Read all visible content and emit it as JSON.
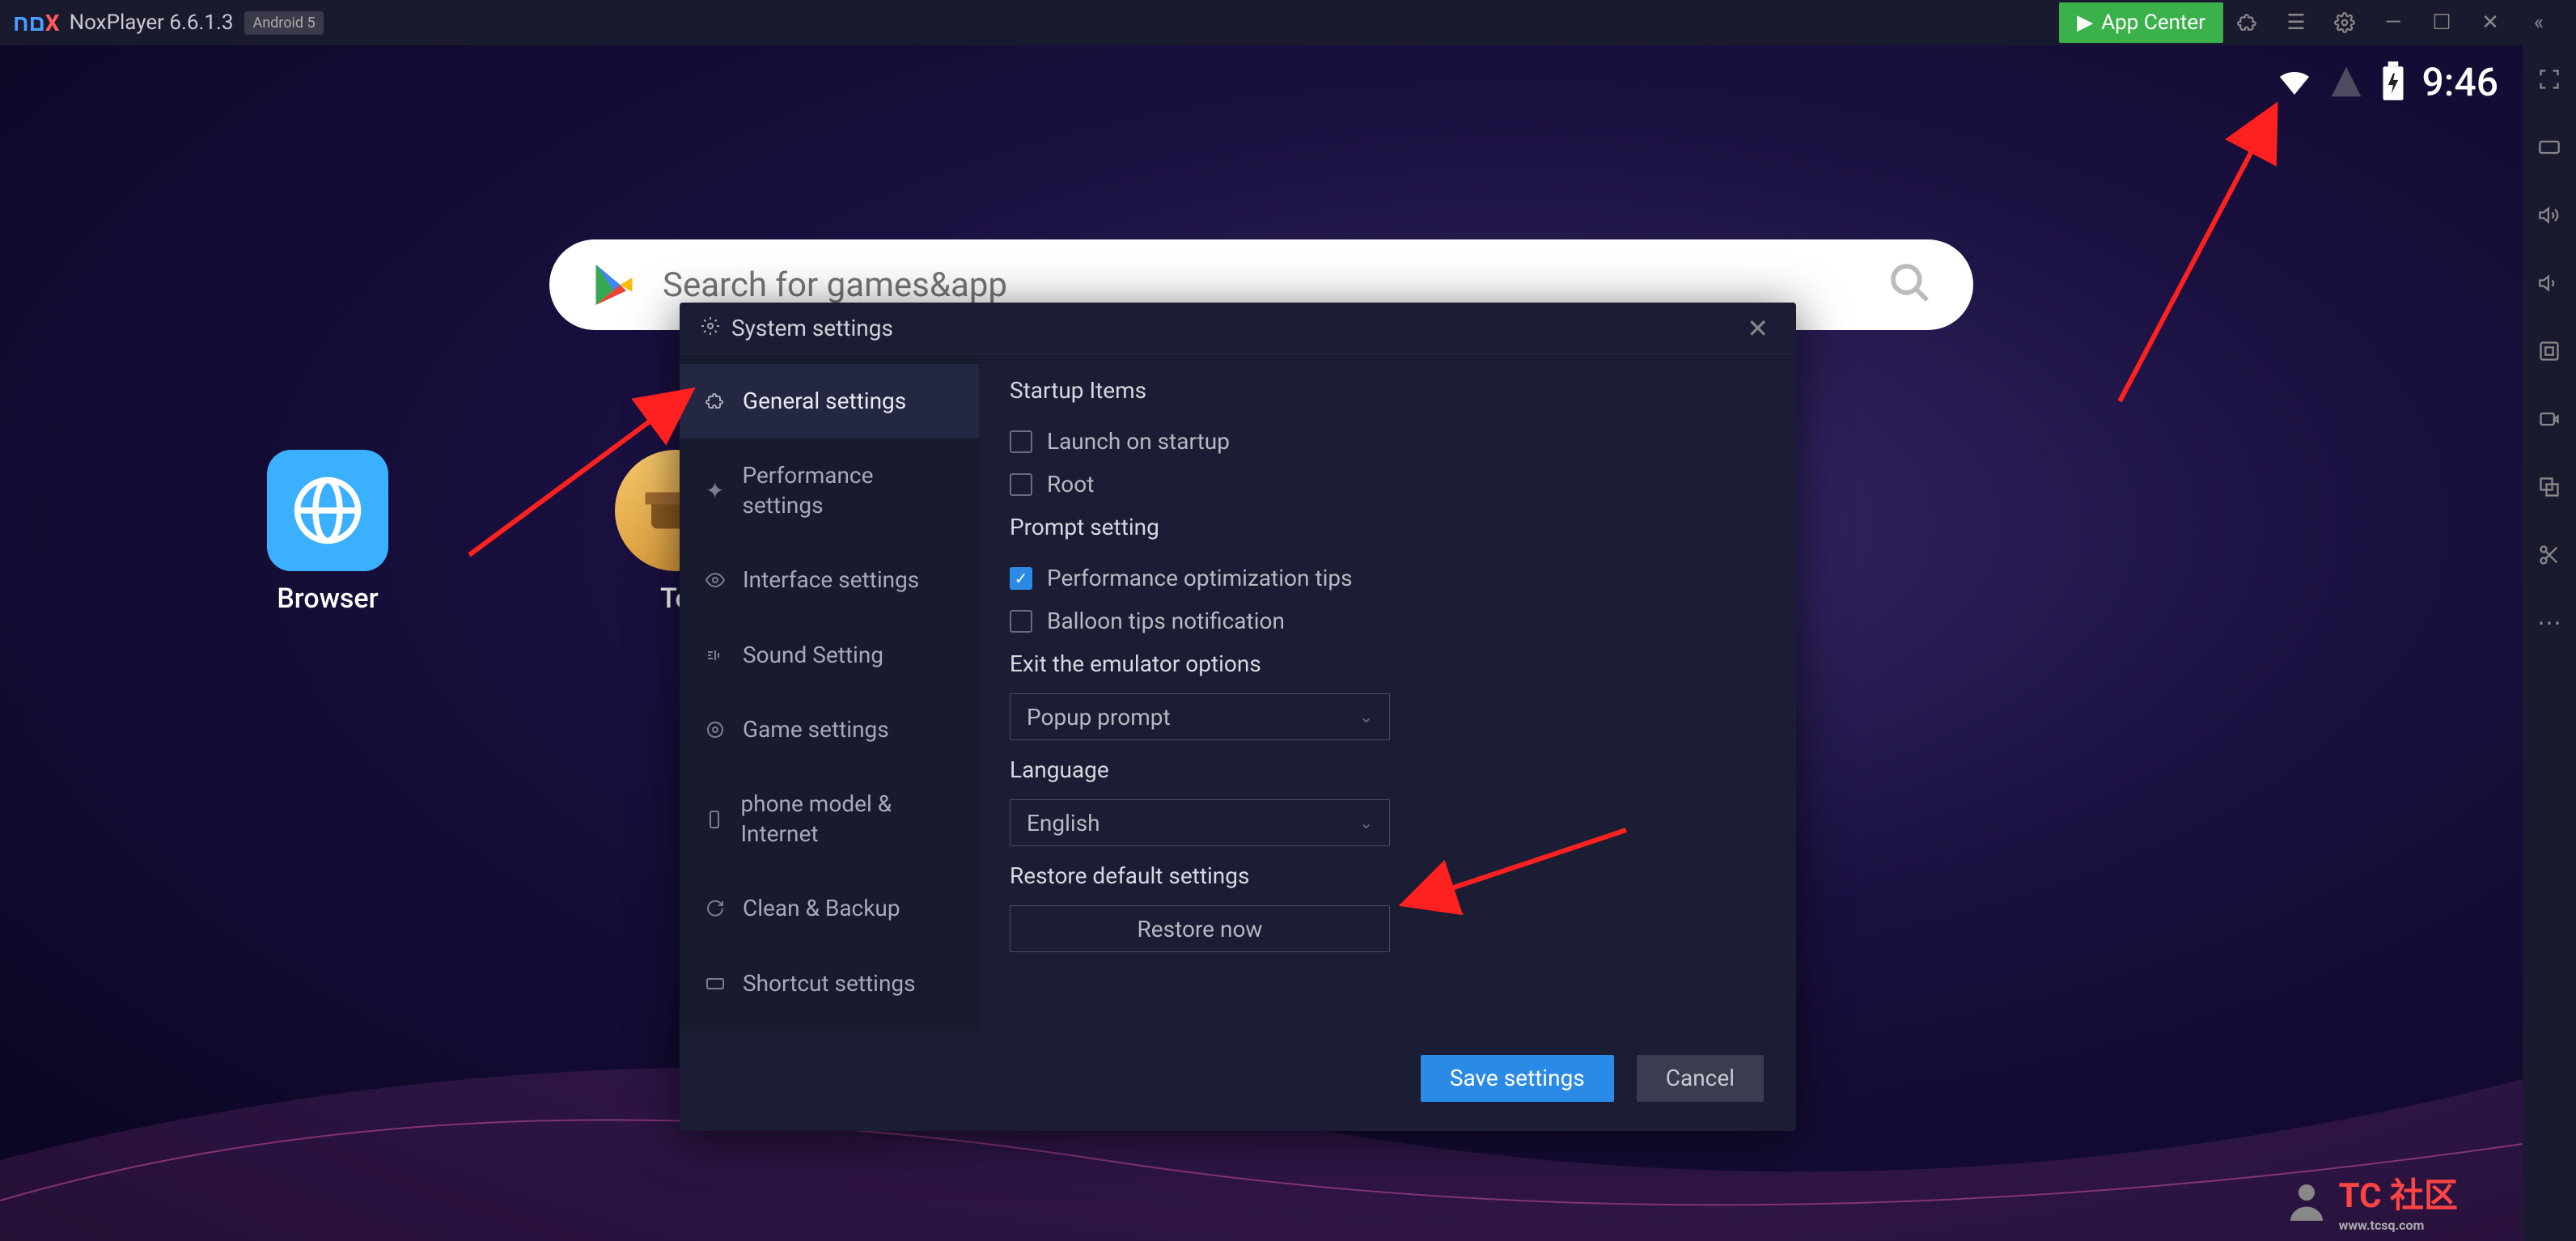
{
  "titlebar": {
    "app_name": "NoxPlayer 6.6.1.3",
    "android_badge": "Android 5",
    "app_center": "App Center"
  },
  "statusbar": {
    "time": "9:46"
  },
  "search": {
    "placeholder": "Search for games&app"
  },
  "desktop": {
    "browser_label": "Browser",
    "second_label": "To"
  },
  "modal": {
    "title": "System settings",
    "sidebar": [
      "General settings",
      "Performance settings",
      "Interface settings",
      "Sound Setting",
      "Game settings",
      "phone model & Internet",
      "Clean & Backup",
      "Shortcut settings"
    ],
    "sections": {
      "startup_title": "Startup Items",
      "launch_on_startup": "Launch on startup",
      "root": "Root",
      "prompt_title": "Prompt setting",
      "perf_tips": "Performance optimization tips",
      "balloon_tips": "Balloon tips notification",
      "exit_title": "Exit the emulator options",
      "exit_value": "Popup prompt",
      "language_title": "Language",
      "language_value": "English",
      "restore_title": "Restore default settings",
      "restore_btn": "Restore now"
    },
    "footer": {
      "save": "Save settings",
      "cancel": "Cancel"
    }
  },
  "watermark": {
    "main": "TC 社区",
    "sub": "www.tcsq.com"
  }
}
